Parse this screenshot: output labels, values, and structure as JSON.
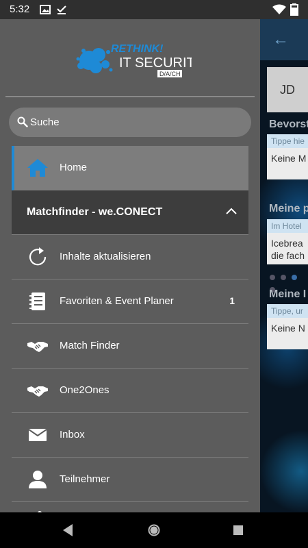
{
  "status_bar": {
    "time": "5:32"
  },
  "drawer": {
    "logo": {
      "line1": "RETHINK!",
      "line2": "IT SECURITY",
      "line3": "D/A/CH"
    },
    "search": {
      "placeholder": "Suche"
    },
    "items": [
      {
        "label": "Home",
        "icon": "home-icon",
        "selected": true
      },
      {
        "label": "Matchfinder - we.CONECT",
        "type": "section",
        "expanded": true
      },
      {
        "label": "Inhalte aktualisieren",
        "icon": "refresh-icon"
      },
      {
        "label": "Favoriten & Event Planer",
        "icon": "planner-icon",
        "count": "1"
      },
      {
        "label": "Match Finder",
        "icon": "handshake-icon"
      },
      {
        "label": "One2Ones",
        "icon": "handshake-icon"
      },
      {
        "label": "Inbox",
        "icon": "mail-icon"
      },
      {
        "label": "Teilnehmer",
        "icon": "person-icon"
      }
    ]
  },
  "background_app": {
    "avatar_initials": "JD",
    "section1_title": "Bevorst",
    "card1_hint": "Tippe hie",
    "card1_body": "Keine M",
    "section2_title": "Meine p",
    "card2_hint": "Im Hotel",
    "card2_body_line1": "Icebrea",
    "card2_body_line2": "die fach",
    "section3_title": "Meine I",
    "card3_hint": "Tippe, ur",
    "card3_body": "Keine N"
  },
  "colors": {
    "accent": "#1e8ad6",
    "drawer_bg": "#5c5c5c",
    "section_bg": "#3d3d3d"
  }
}
